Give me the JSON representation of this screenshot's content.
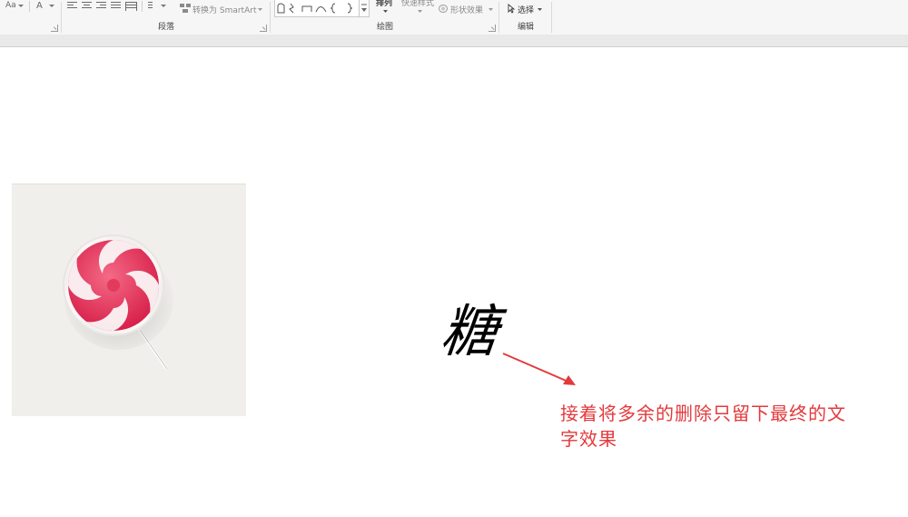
{
  "ribbon": {
    "font": {
      "aa_label": "Aa",
      "a_label": "A"
    },
    "paragraph": {
      "group_label": "段落",
      "smartart_label": "转换为 SmartArt"
    },
    "drawing": {
      "group_label": "绘图",
      "arrange_label": "排列",
      "quick_styles_label": "快速样式",
      "shape_effects_label": "形状效果"
    },
    "editing": {
      "group_label": "编辑",
      "select_label": "选择"
    }
  },
  "slide": {
    "character": "糖",
    "annotation_text": "接着将多余的删除只留下最终的文字效果"
  },
  "colors": {
    "annotation": "#e4393c",
    "arrow": "#e4393c",
    "candy_pink": "#e8365e"
  }
}
